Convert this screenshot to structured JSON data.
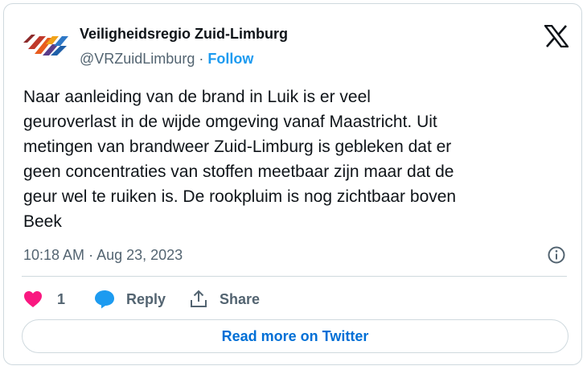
{
  "author": {
    "name": "Veiligheidsregio Zuid-Limburg",
    "handle": "@VRZuidLimburg",
    "separator": "·",
    "follow_label": "Follow"
  },
  "tweet": {
    "text": "Naar aanleiding van de brand in Luik is er veel\ngeuroverlast in de wijde omgeving vanaf Maastricht. Uit\nmetingen van brandweer Zuid-Limburg is gebleken dat er\ngeen concentraties van stoffen meetbaar zijn maar dat de\ngeur wel te ruiken is. De rookpluim is nog zichtbaar boven\nBeek",
    "time": "10:18 AM",
    "meta_separator": "·",
    "date": "Aug 23, 2023"
  },
  "actions": {
    "like_count": "1",
    "reply_label": "Reply",
    "share_label": "Share"
  },
  "read_more_label": "Read more on Twitter",
  "colors": {
    "text": "#0f1419",
    "secondary": "#536471",
    "link": "#1d9bf0",
    "heart": "#f91880",
    "reply_bubble": "#1d9bf0",
    "border": "#cfd9de"
  },
  "icons": [
    "vrzl-logo",
    "x-logo-icon",
    "info-icon",
    "heart-icon",
    "reply-icon",
    "share-icon"
  ]
}
